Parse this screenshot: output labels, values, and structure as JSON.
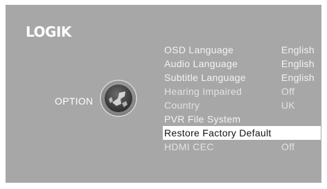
{
  "brand": {
    "logo_text": "LOGIK"
  },
  "sidebar": {
    "section_label": "OPTION",
    "section_icon": "option-globe-icon"
  },
  "menu": {
    "items": [
      {
        "label": "OSD Language",
        "value": "English",
        "state": "normal"
      },
      {
        "label": "Audio Language",
        "value": "English",
        "state": "normal"
      },
      {
        "label": "Subtitle Language",
        "value": "English",
        "state": "normal"
      },
      {
        "label": "Hearing Impaired",
        "value": "Off",
        "state": "dim"
      },
      {
        "label": "Country",
        "value": "UK",
        "state": "dim"
      },
      {
        "label": "PVR File System",
        "value": "",
        "state": "normal"
      },
      {
        "label": "Restore Factory Default",
        "value": "",
        "state": "selected"
      },
      {
        "label": "HDMI CEC",
        "value": "Off",
        "state": "dim"
      }
    ]
  },
  "colors": {
    "screen_bg": "#a7a7a7",
    "text": "#f3f3f3",
    "highlight_bg": "#ffffff",
    "highlight_text": "#111111"
  }
}
